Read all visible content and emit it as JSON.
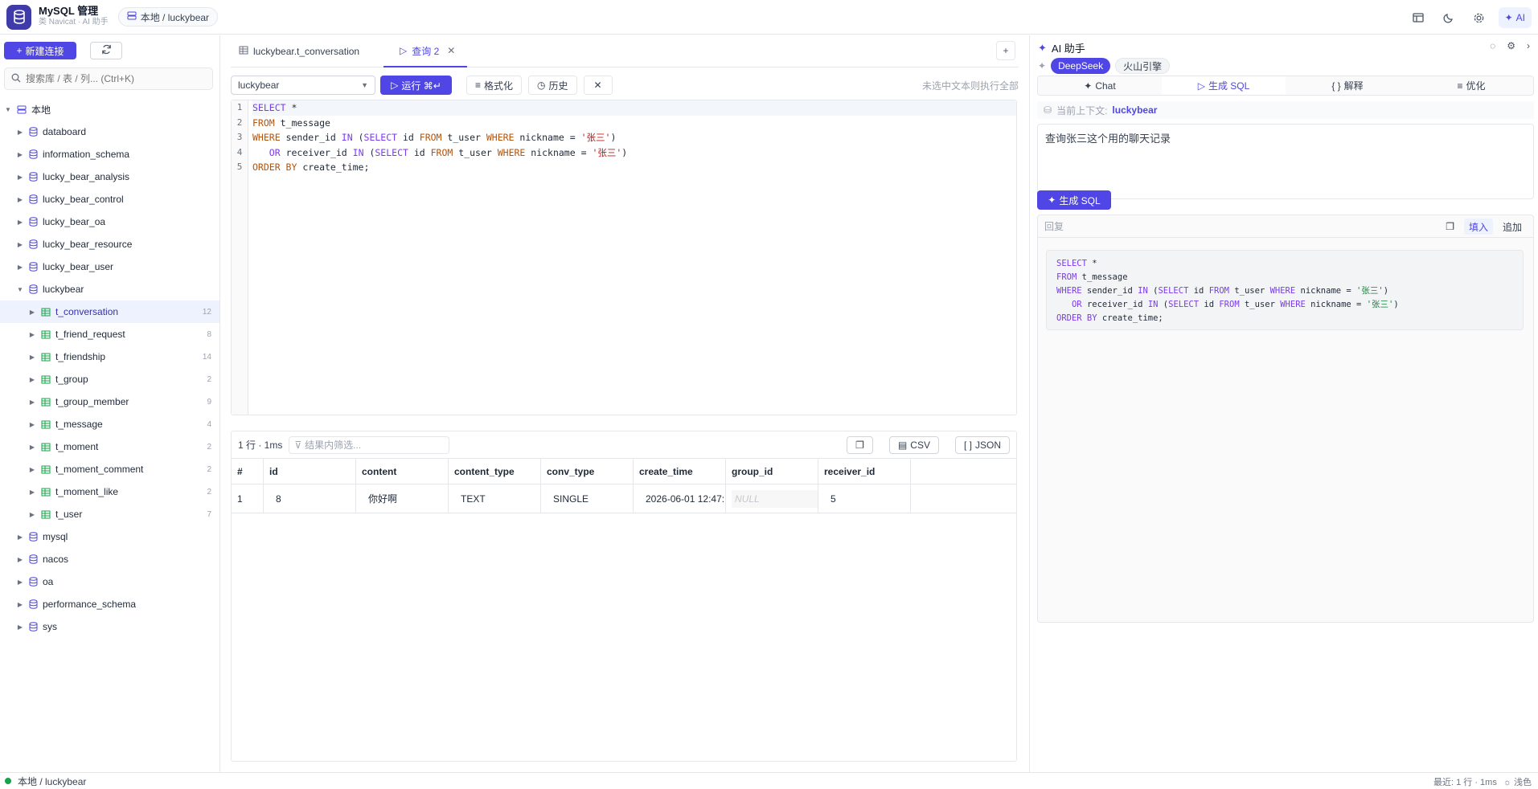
{
  "app": {
    "title": "MySQL 管理",
    "subtitle": "类 Navicat · AI 助手",
    "breadcrumb": "本地 / luckybear",
    "ai_button": "AI"
  },
  "sidebar": {
    "new_connection": "新建连接",
    "search_placeholder": "搜索库 / 表 / 列... (Ctrl+K)",
    "root": "本地",
    "databases_before": [
      "databoard",
      "information_schema",
      "lucky_bear_analysis",
      "lucky_bear_control",
      "lucky_bear_oa",
      "lucky_bear_resource",
      "lucky_bear_user"
    ],
    "open_db": "luckybear",
    "tables": [
      {
        "name": "t_conversation",
        "count": "12"
      },
      {
        "name": "t_friend_request",
        "count": "8"
      },
      {
        "name": "t_friendship",
        "count": "14"
      },
      {
        "name": "t_group",
        "count": "2"
      },
      {
        "name": "t_group_member",
        "count": "9"
      },
      {
        "name": "t_message",
        "count": "4"
      },
      {
        "name": "t_moment",
        "count": "2"
      },
      {
        "name": "t_moment_comment",
        "count": "2"
      },
      {
        "name": "t_moment_like",
        "count": "2"
      },
      {
        "name": "t_user",
        "count": "7"
      }
    ],
    "databases_after": [
      "mysql",
      "nacos",
      "oa",
      "performance_schema",
      "sys"
    ]
  },
  "editor": {
    "tabs": [
      {
        "label": "luckybear.t_conversation"
      },
      {
        "label": "查询 2"
      }
    ],
    "db_select": "luckybear",
    "run_label": "运行 ⌘↵",
    "format_label": "格式化",
    "history_label": "历史",
    "hint": "未选中文本则执行全部",
    "line_numbers": [
      "1",
      "2",
      "3",
      "4",
      "5"
    ]
  },
  "results": {
    "info": "1 行 · 1ms",
    "filter_placeholder": "结果内筛选...",
    "csv": "CSV",
    "json": "JSON",
    "columns": [
      "#",
      "id",
      "content",
      "content_type",
      "conv_type",
      "create_time",
      "group_id",
      "receiver_id"
    ],
    "rows": [
      [
        "1",
        "8",
        "你好啊",
        "TEXT",
        "SINGLE",
        "2026-06-01 12:47:...",
        "NULL",
        "5"
      ]
    ]
  },
  "ai": {
    "title": "AI 助手",
    "models": [
      "DeepSeek",
      "火山引擎"
    ],
    "modes": [
      "Chat",
      "生成 SQL",
      "解释",
      "优化"
    ],
    "context_label": "当前上下文:",
    "context_value": "luckybear",
    "prompt": "查询张三这个用的聊天记录",
    "generate_label": "生成 SQL",
    "reply_label": "回复",
    "fill_label": "填入",
    "append_label": "追加"
  },
  "status": {
    "connection": "本地 / luckybear",
    "recent": "最近: 1 行 · 1ms",
    "theme": "浅色"
  }
}
